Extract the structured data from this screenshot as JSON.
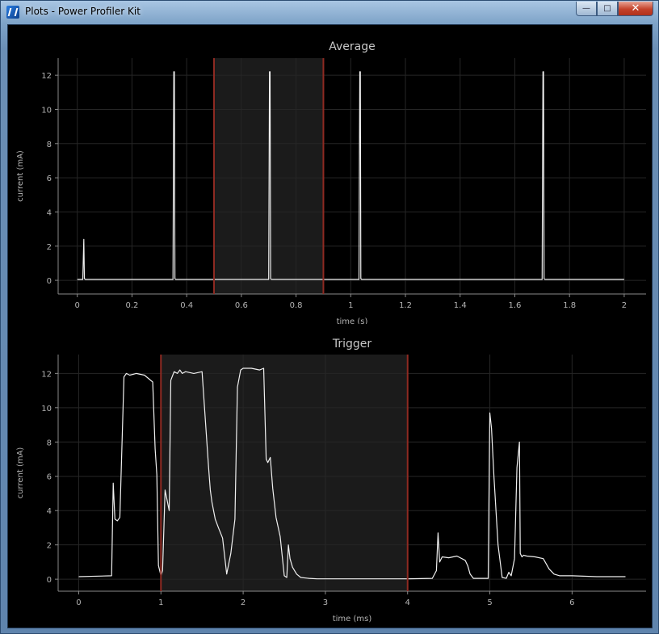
{
  "window": {
    "title": "Plots - Power Profiler Kit",
    "buttons": {
      "minimize": "—",
      "maximize": "□",
      "close": "✕"
    }
  },
  "chart_data": [
    {
      "type": "line",
      "title": "Average",
      "xlabel": "time (s)",
      "ylabel": "current (mA)",
      "xlim": [
        -0.07,
        2.08
      ],
      "ylim": [
        -0.8,
        13.0
      ],
      "xticks": [
        0,
        0.2,
        0.4,
        0.6,
        0.8,
        1,
        1.2,
        1.4,
        1.6,
        1.8,
        2
      ],
      "xtick_labels": [
        "0",
        "0.2",
        "0.4",
        "0.6",
        "0.8",
        "1",
        "1.2",
        "1.4",
        "1.6",
        "1.8",
        "2"
      ],
      "yticks": [
        0,
        2,
        4,
        6,
        8,
        10,
        12
      ],
      "ytick_labels": [
        "0",
        "2",
        "4",
        "6",
        "8",
        "10",
        "12"
      ],
      "grid": true,
      "selection": [
        0.5,
        0.9
      ],
      "series": [
        {
          "x": [
            0,
            0.02,
            0.024,
            0.026,
            0.03,
            0.35,
            0.353,
            0.355,
            0.357,
            0.36,
            0.7,
            0.703,
            0.705,
            0.707,
            0.71,
            1.03,
            1.033,
            1.035,
            1.037,
            1.04,
            1.7,
            1.703,
            1.705,
            1.707,
            1.71,
            2.0
          ],
          "values": [
            0.05,
            0.05,
            2.4,
            0.1,
            0.05,
            0.05,
            12.2,
            12.2,
            0.1,
            0.05,
            0.05,
            12.2,
            12.2,
            0.1,
            0.05,
            0.05,
            12.2,
            12.2,
            0.1,
            0.05,
            0.05,
            12.2,
            12.2,
            0.1,
            0.05,
            0.05
          ]
        }
      ]
    },
    {
      "type": "line",
      "title": "Trigger",
      "xlabel": "time (ms)",
      "ylabel": "current (mA)",
      "xlim": [
        -0.25,
        6.9
      ],
      "ylim": [
        -0.7,
        13.1
      ],
      "xticks": [
        0,
        1,
        2,
        3,
        4,
        5,
        6
      ],
      "xtick_labels": [
        "0",
        "1",
        "2",
        "3",
        "4",
        "5",
        "6"
      ],
      "yticks": [
        0,
        2,
        4,
        6,
        8,
        10,
        12
      ],
      "ytick_labels": [
        "0",
        "2",
        "4",
        "6",
        "8",
        "10",
        "12"
      ],
      "grid": true,
      "selection": [
        1.0,
        4.0
      ],
      "series": [
        {
          "x": [
            0,
            0.4,
            0.42,
            0.44,
            0.47,
            0.5,
            0.55,
            0.58,
            0.62,
            0.7,
            0.8,
            0.9,
            0.93,
            0.95,
            0.97,
            1.0,
            1.02,
            1.05,
            1.1,
            1.12,
            1.16,
            1.2,
            1.23,
            1.26,
            1.3,
            1.4,
            1.5,
            1.58,
            1.6,
            1.62,
            1.66,
            1.7,
            1.75,
            1.8,
            1.85,
            1.9,
            1.93,
            1.97,
            2.0,
            2.1,
            2.2,
            2.25,
            2.28,
            2.3,
            2.33,
            2.36,
            2.4,
            2.45,
            2.5,
            2.53,
            2.55,
            2.57,
            2.6,
            2.65,
            2.7,
            2.8,
            2.9,
            3.0,
            3.5,
            4.0,
            4.3,
            4.35,
            4.37,
            4.39,
            4.42,
            4.5,
            4.6,
            4.7,
            4.73,
            4.76,
            4.8,
            4.98,
            5.0,
            5.02,
            5.05,
            5.1,
            5.15,
            5.2,
            5.23,
            5.26,
            5.3,
            5.33,
            5.36,
            5.37,
            5.39,
            5.41,
            5.45,
            5.55,
            5.65,
            5.72,
            5.78,
            5.85,
            6.0,
            6.3,
            6.65
          ],
          "values": [
            0.15,
            0.2,
            5.6,
            3.5,
            3.4,
            3.6,
            11.8,
            12.0,
            11.9,
            12.0,
            11.9,
            11.5,
            7.6,
            6.1,
            0.8,
            0.2,
            0.5,
            5.2,
            4.0,
            11.6,
            12.1,
            12.0,
            12.2,
            12.0,
            12.1,
            12.0,
            12.1,
            6.5,
            5.2,
            4.5,
            3.5,
            3.0,
            2.4,
            0.3,
            1.5,
            3.5,
            11.2,
            12.2,
            12.3,
            12.3,
            12.2,
            12.3,
            7.0,
            6.8,
            7.1,
            5.3,
            3.6,
            2.5,
            0.2,
            0.1,
            2.0,
            1.2,
            0.7,
            0.3,
            0.1,
            0.05,
            0.02,
            0.02,
            0.02,
            0.02,
            0.05,
            0.5,
            2.7,
            1.0,
            1.3,
            1.25,
            1.35,
            1.1,
            0.8,
            0.3,
            0.05,
            0.05,
            9.7,
            8.8,
            6.0,
            2.0,
            0.1,
            0.05,
            0.4,
            0.2,
            1.2,
            6.5,
            8.0,
            1.5,
            1.3,
            1.4,
            1.35,
            1.3,
            1.2,
            0.6,
            0.3,
            0.2,
            0.2,
            0.15,
            0.15
          ]
        }
      ]
    }
  ]
}
